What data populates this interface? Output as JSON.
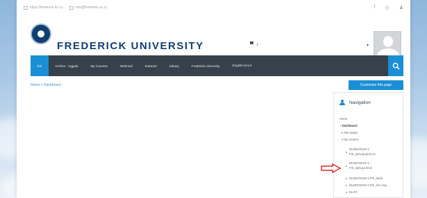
{
  "topbar": {
    "website": "https://frederick.ac.cy",
    "email": "info@frederick.ac.cy",
    "social_icons": [
      "facebook-icon",
      "instagram-icon",
      "user-icon"
    ]
  },
  "header": {
    "brand": "FREDERICK UNIVERSITY",
    "icons": [
      "chat-icon",
      "bell-icon"
    ]
  },
  "navbar": {
    "home": "Ein",
    "items": [
      "Archive - Aggela",
      "My Courses",
      "Webmail",
      "Extranet",
      "Library",
      "Frederick University",
      "English (en) ▾"
    ]
  },
  "breadcrumb": "Home > Dashboard",
  "customise_button": "Customise this page",
  "navigation_block": {
    "title": "Navigation",
    "home": "Home",
    "dashboard": "Dashboard",
    "site_pages": "Site pages",
    "my_courses": "My courses",
    "courses": [
      {
        "line1": "DLMDVD102-1-",
        "line2": "FIK_adm.pp.pres.ex"
      },
      {
        "line1": "DLMDVD101-1-",
        "line2": "FIK_adm.pp.heck"
      },
      {
        "line1": "DLMDVD108-1-FIK_hecik",
        "line2": ""
      },
      {
        "line1": "DLMDVD103-1-FIK_hec.eng",
        "line2": ""
      },
      {
        "line1": "DLGP",
        "line2": ""
      }
    ]
  },
  "colors": {
    "navbar": "#364149",
    "accent": "#1a8fd5",
    "brand": "#123f70",
    "pointer_arrow": "#e0272f"
  }
}
